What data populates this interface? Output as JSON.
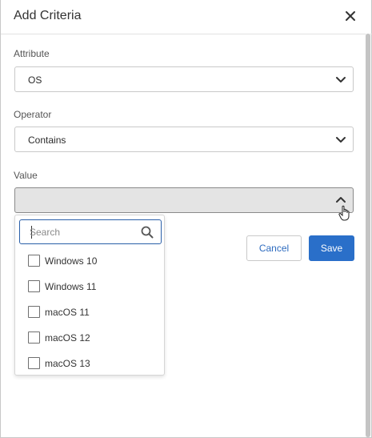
{
  "dialog": {
    "title": "Add Criteria",
    "close_icon": "close-icon"
  },
  "fields": {
    "attribute": {
      "label": "Attribute",
      "value": "OS"
    },
    "operator": {
      "label": "Operator",
      "value": "Contains"
    },
    "value": {
      "label": "Value",
      "value": ""
    }
  },
  "dropdown": {
    "search_placeholder": "Search",
    "search_icon": "search-icon",
    "options": [
      {
        "label": "Windows 10",
        "checked": false
      },
      {
        "label": "Windows 11",
        "checked": false
      },
      {
        "label": "macOS 11",
        "checked": false
      },
      {
        "label": "macOS 12",
        "checked": false
      },
      {
        "label": "macOS 13",
        "checked": false
      }
    ]
  },
  "actions": {
    "cancel_label": "Cancel",
    "save_label": "Save"
  },
  "colors": {
    "primary": "#2a6fc9",
    "link": "#2d6bbf",
    "focus_border": "#2a5fa8"
  }
}
